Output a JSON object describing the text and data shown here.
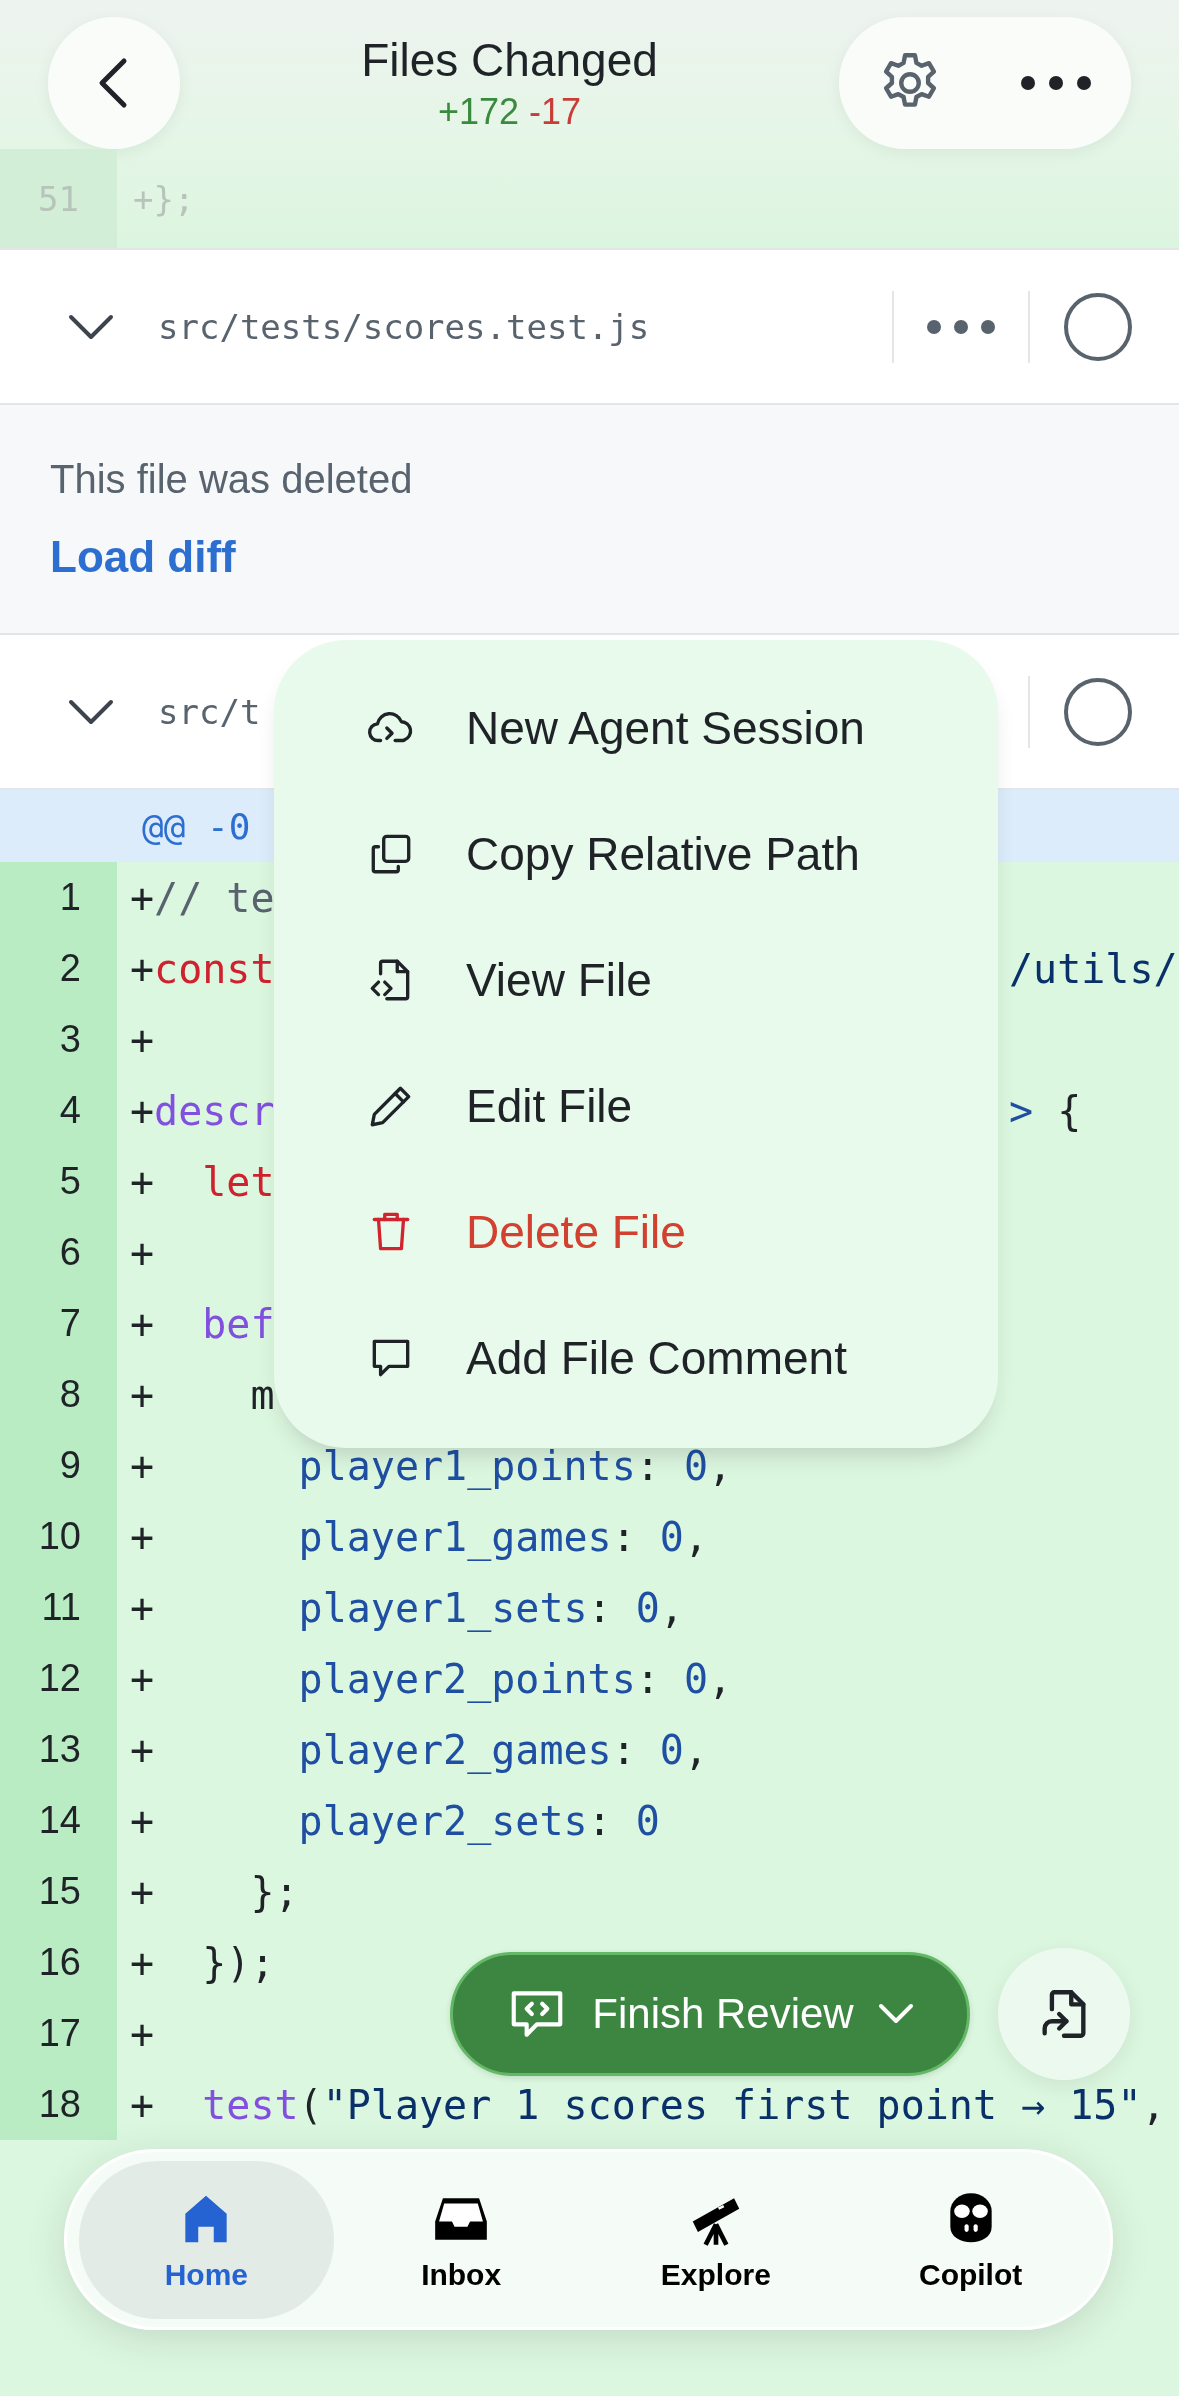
{
  "header": {
    "title": "Files Changed",
    "additions": "+172",
    "deletions": "-17",
    "behind_line": {
      "number": "51",
      "text": "+};"
    }
  },
  "files": [
    {
      "path": "src/tests/scores.test.js",
      "viewed": false,
      "notice": "This file was deleted",
      "action": "Load diff"
    },
    {
      "path": "src/t",
      "viewed": false,
      "hunk": "@@ -0",
      "lines": [
        {
          "number": "1",
          "tokens": [
            {
              "text": "+",
              "kind": "plain"
            },
            {
              "text": "// te",
              "kind": "comment"
            }
          ]
        },
        {
          "number": "2",
          "tokens": [
            {
              "text": "+",
              "kind": "plain"
            },
            {
              "text": "const",
              "kind": "keyword"
            }
          ],
          "tail": [
            {
              "text": "/utils/",
              "kind": "string"
            }
          ]
        },
        {
          "number": "3",
          "tokens": [
            {
              "text": "+",
              "kind": "plain"
            }
          ]
        },
        {
          "number": "4",
          "tokens": [
            {
              "text": "+",
              "kind": "plain"
            },
            {
              "text": "descr",
              "kind": "function"
            }
          ],
          "tail": [
            {
              "text": ">",
              "kind": "property"
            },
            {
              "text": " {",
              "kind": "plain"
            }
          ]
        },
        {
          "number": "5",
          "tokens": [
            {
              "text": "+  ",
              "kind": "plain"
            },
            {
              "text": "let",
              "kind": "keyword"
            }
          ]
        },
        {
          "number": "6",
          "tokens": [
            {
              "text": "+",
              "kind": "plain"
            }
          ]
        },
        {
          "number": "7",
          "tokens": [
            {
              "text": "+  ",
              "kind": "plain"
            },
            {
              "text": "bef",
              "kind": "function"
            }
          ]
        },
        {
          "number": "8",
          "tokens": [
            {
              "text": "+    m",
              "kind": "plain"
            }
          ]
        },
        {
          "number": "9",
          "tokens": [
            {
              "text": "+      ",
              "kind": "plain"
            },
            {
              "text": "player1_points",
              "kind": "property"
            },
            {
              "text": ": ",
              "kind": "plain"
            },
            {
              "text": "0",
              "kind": "number"
            },
            {
              "text": ",",
              "kind": "plain"
            }
          ]
        },
        {
          "number": "10",
          "tokens": [
            {
              "text": "+      ",
              "kind": "plain"
            },
            {
              "text": "player1_games",
              "kind": "property"
            },
            {
              "text": ": ",
              "kind": "plain"
            },
            {
              "text": "0",
              "kind": "number"
            },
            {
              "text": ",",
              "kind": "plain"
            }
          ]
        },
        {
          "number": "11",
          "tokens": [
            {
              "text": "+      ",
              "kind": "plain"
            },
            {
              "text": "player1_sets",
              "kind": "property"
            },
            {
              "text": ": ",
              "kind": "plain"
            },
            {
              "text": "0",
              "kind": "number"
            },
            {
              "text": ",",
              "kind": "plain"
            }
          ]
        },
        {
          "number": "12",
          "tokens": [
            {
              "text": "+      ",
              "kind": "plain"
            },
            {
              "text": "player2_points",
              "kind": "property"
            },
            {
              "text": ": ",
              "kind": "plain"
            },
            {
              "text": "0",
              "kind": "number"
            },
            {
              "text": ",",
              "kind": "plain"
            }
          ]
        },
        {
          "number": "13",
          "tokens": [
            {
              "text": "+      ",
              "kind": "plain"
            },
            {
              "text": "player2_games",
              "kind": "property"
            },
            {
              "text": ": ",
              "kind": "plain"
            },
            {
              "text": "0",
              "kind": "number"
            },
            {
              "text": ",",
              "kind": "plain"
            }
          ]
        },
        {
          "number": "14",
          "tokens": [
            {
              "text": "+      ",
              "kind": "plain"
            },
            {
              "text": "player2_sets",
              "kind": "property"
            },
            {
              "text": ": ",
              "kind": "plain"
            },
            {
              "text": "0",
              "kind": "number"
            }
          ]
        },
        {
          "number": "15",
          "tokens": [
            {
              "text": "+    };",
              "kind": "plain"
            }
          ]
        },
        {
          "number": "16",
          "tokens": [
            {
              "text": "+  });",
              "kind": "plain"
            }
          ]
        },
        {
          "number": "17",
          "tokens": [
            {
              "text": "+",
              "kind": "plain"
            }
          ]
        },
        {
          "number": "18",
          "tokens": [
            {
              "text": "+  ",
              "kind": "plain"
            },
            {
              "text": "test",
              "kind": "function"
            },
            {
              "text": "(",
              "kind": "plain"
            },
            {
              "text": "\"Player 1 scores first point → 15\"",
              "kind": "string"
            },
            {
              "text": ",",
              "kind": "plain"
            }
          ]
        }
      ]
    }
  ],
  "menu": {
    "items": [
      {
        "label": "New Agent Session",
        "kind": "agent",
        "destructive": false
      },
      {
        "label": "Copy Relative Path",
        "kind": "copy",
        "destructive": false
      },
      {
        "label": "View File",
        "kind": "view",
        "destructive": false
      },
      {
        "label": "Edit File",
        "kind": "edit",
        "destructive": false
      },
      {
        "label": "Delete File",
        "kind": "delete",
        "destructive": true
      },
      {
        "label": "Add File Comment",
        "kind": "comment",
        "destructive": false
      }
    ]
  },
  "finish_button": {
    "label": "Finish Review"
  },
  "nav": {
    "items": [
      {
        "label": "Home",
        "kind": "home",
        "selected": true
      },
      {
        "label": "Inbox",
        "kind": "inbox",
        "selected": false
      },
      {
        "label": "Explore",
        "kind": "explore",
        "selected": false
      },
      {
        "label": "Copilot",
        "kind": "copilot",
        "selected": false
      }
    ]
  }
}
